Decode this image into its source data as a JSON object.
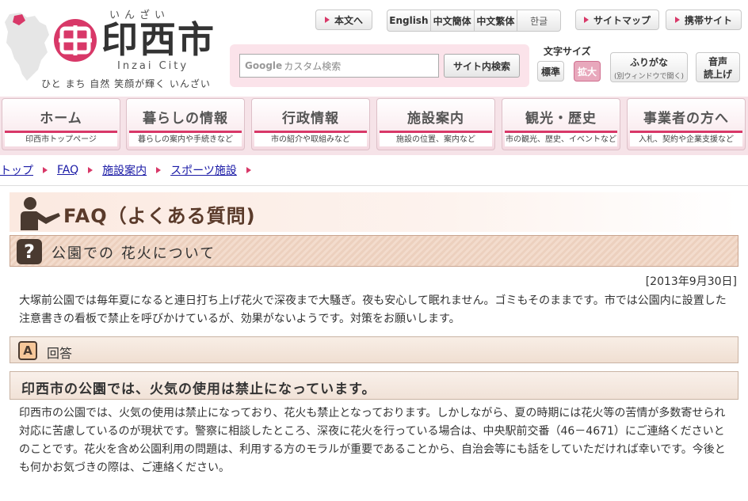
{
  "header": {
    "logo_ruby": "いんざい",
    "logo_title": "印西市",
    "logo_en": "Inzai City",
    "slogan": "ひと まち 自然 笑顔が輝く いんざい",
    "skip_label": "本文へ",
    "languages": [
      "English",
      "中文簡体",
      "中文繁体",
      "한글"
    ],
    "sitemap_label": "サイトマップ",
    "mobile_label": "携帯サイト",
    "search": {
      "google_prefix": "Google",
      "placeholder": "カスタム検索",
      "button": "サイト内検索"
    },
    "font_size": {
      "label": "文字サイズ",
      "standard": "標準",
      "large": "拡大"
    },
    "furigana": {
      "label": "ふりがな",
      "sub": "(別ウィンドウで開く)"
    },
    "voice": {
      "line1": "音声",
      "line2": "読上げ"
    },
    "accent_color": "#d83868"
  },
  "nav": [
    {
      "label": "ホーム",
      "sub": "印西市トップページ"
    },
    {
      "label": "暮らしの情報",
      "sub": "暮らしの案内や手続きなど"
    },
    {
      "label": "行政情報",
      "sub": "市の紹介や取組みなど"
    },
    {
      "label": "施設案内",
      "sub": "施設の位置、案内など"
    },
    {
      "label": "観光・歴史",
      "sub": "市の観光、歴史、イベントなど"
    },
    {
      "label": "事業者の方へ",
      "sub": "入札、契約や企業支援など"
    }
  ],
  "breadcrumb": [
    "トップ",
    "FAQ",
    "施設案内",
    "スポーツ施設"
  ],
  "page": {
    "title": "FAQ（よくある質問)",
    "question_title": "公園での 花火について",
    "date": "[2013年9月30日]",
    "question_body": "大塚前公園では毎年夏になると連日打ち上げ花火で深夜まで大騒ぎ。夜も安心して眠れません。ゴミもそのままです。市では公園内に設置した注意書きの看板で禁止を呼びかけているが、効果がないようです。対策をお願いします。",
    "q_icon": "?",
    "a_icon": "A",
    "answer_label": "回答",
    "answer_heading": "印西市の公園では、火気の使用は禁止になっています。",
    "answer_body": "印西市の公園では、火気の使用は禁止になっており、花火も禁止となっております。しかしながら、夏の時期には花火等の苦情が多数寄せられ対応に苦慮しているのが現状です。警察に相談したところ、深夜に花火を行っている場合は、中央駅前交番（46－4671）にご連絡くださいとのことです。花火を含め公園利用の問題は、利用する方のモラルが重要であることから、自治会等にも話をしていただければ幸いです。今後とも何かお気づきの際は、ご連絡ください。"
  }
}
